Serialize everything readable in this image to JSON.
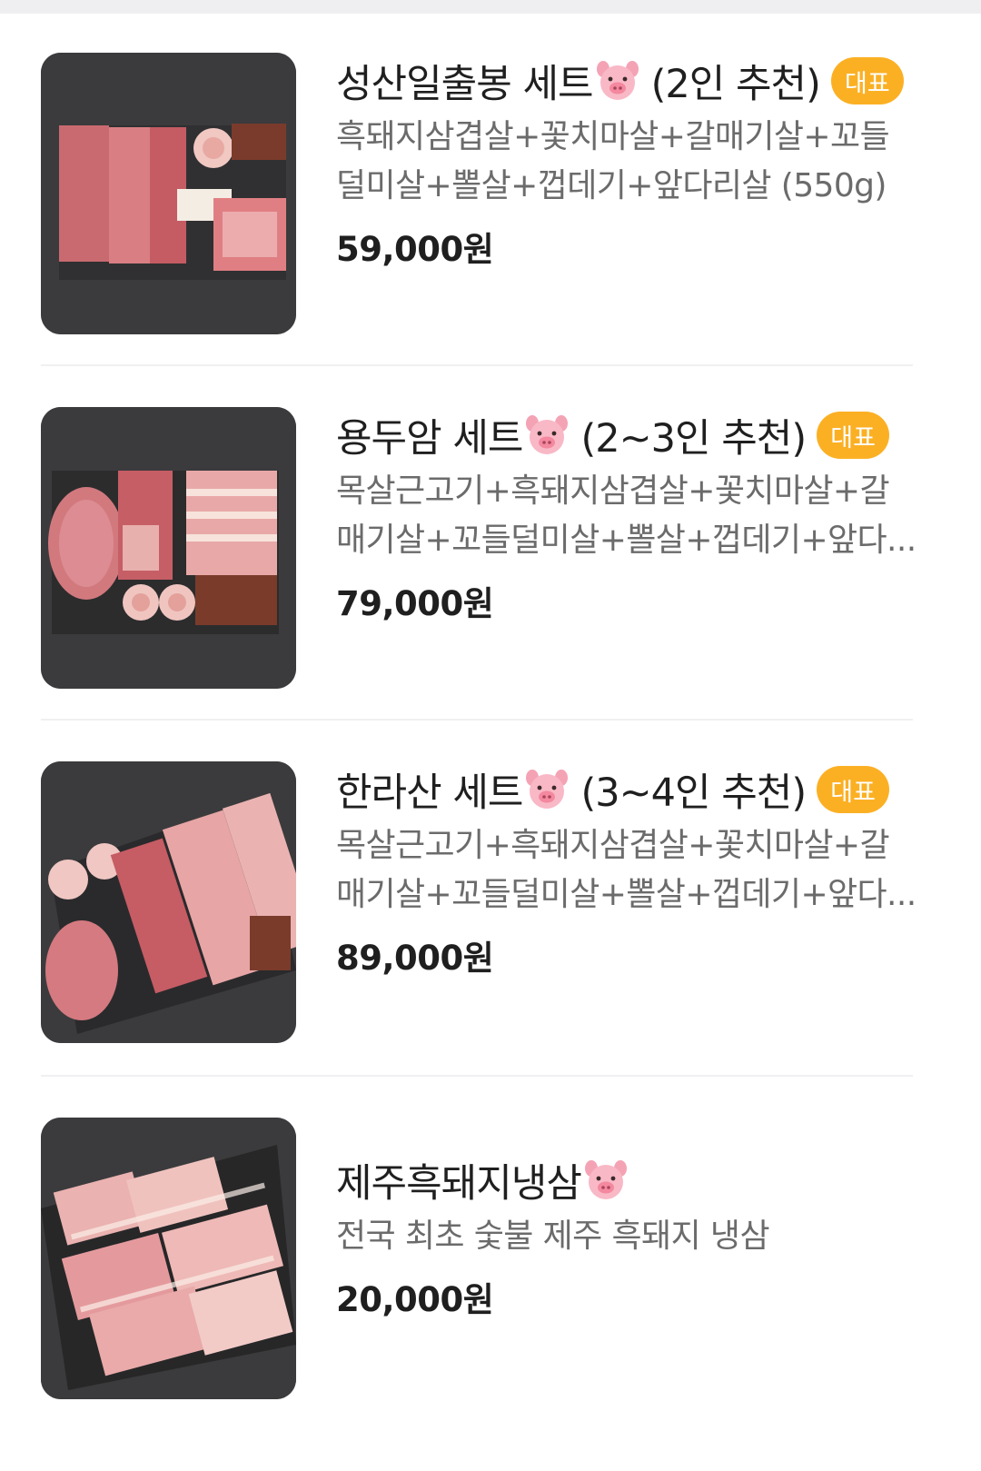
{
  "colors": {
    "badge_bg": "#fbb024",
    "title": "#1f1f1f",
    "description": "#6b6b6b",
    "divider": "#f0f0f2",
    "top_strip": "#efeff1"
  },
  "menu": {
    "items": [
      {
        "name": "성산일출봉 세트",
        "serving": "(2인 추천)",
        "badge": "대표",
        "icon": "pig-face-icon",
        "description": "흑돼지삼겹살+꽃치마살+갈매기살+꼬들덜미살+뽈살+껍데기+앞다리살 (550g)",
        "price": "59,000원"
      },
      {
        "name": "용두암 세트",
        "serving": "(2~3인 추천)",
        "badge": "대표",
        "icon": "pig-face-icon",
        "description": "목살근고기+흑돼지삼겹살+꽃치마살+갈매기살+꼬들덜미살+뽈살+껍데기+앞다...",
        "price": "79,000원"
      },
      {
        "name": "한라산 세트",
        "serving": "(3~4인 추천)",
        "badge": "대표",
        "icon": "pig-face-icon",
        "description": "목살근고기+흑돼지삼겹살+꽃치마살+갈매기살+꼬들덜미살+뽈살+껍데기+앞다...",
        "price": "89,000원"
      },
      {
        "name": "제주흑돼지냉삼",
        "serving": "",
        "badge": "",
        "icon": "pig-face-icon",
        "description": "전국 최초 숯불 제주 흑돼지 냉삼",
        "price": "20,000원"
      }
    ]
  }
}
